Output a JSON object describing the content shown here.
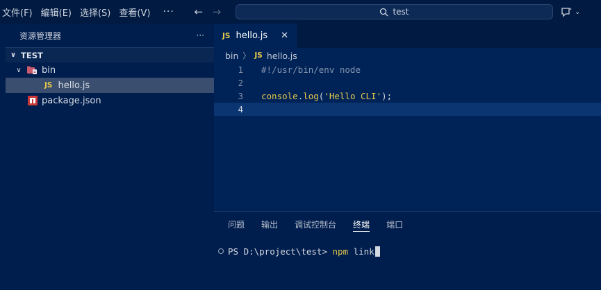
{
  "menu": {
    "items": [
      "文件(F)",
      "编辑(E)",
      "选择(S)",
      "查看(V)"
    ],
    "more": "···"
  },
  "search": {
    "text": "test"
  },
  "sidebar": {
    "title": "资源管理器",
    "more": "···",
    "section": "TEST",
    "tree": [
      {
        "label": "bin",
        "type": "folder",
        "expanded": true
      },
      {
        "label": "hello.js",
        "type": "js",
        "badge": "JS",
        "selected": true
      },
      {
        "label": "package.json",
        "type": "npm"
      }
    ]
  },
  "editor": {
    "tab": {
      "badge": "JS",
      "label": "hello.js",
      "close": "✕"
    },
    "breadcrumb": {
      "folder": "bin",
      "badge": "JS",
      "file": "hello.js"
    },
    "lines": [
      {
        "num": "1",
        "text": "#!/usr/bin/env node"
      },
      {
        "num": "2",
        "text": ""
      },
      {
        "num": "3",
        "ident": "console",
        "dot": ".",
        "method": "log",
        "open": "(",
        "str": "'Hello CLI'",
        "close": ");"
      },
      {
        "num": "4",
        "text": ""
      }
    ]
  },
  "panel": {
    "tabs": [
      "问题",
      "输出",
      "调试控制台",
      "终端",
      "端口"
    ],
    "active_tab": "终端",
    "terminal": {
      "prompt": "PS D:\\project\\test> ",
      "cmd": "npm",
      "args": " link"
    }
  },
  "colors": {
    "accent_yellow": "#e8c84a",
    "npm_red": "#cb3837",
    "bg": "#001e4d"
  }
}
